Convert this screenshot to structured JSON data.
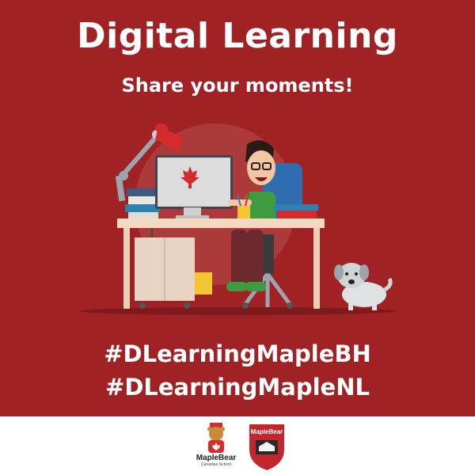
{
  "poster": {
    "title": "Digital Learning",
    "subtitle": "Share your moments!",
    "hashtags": [
      "#DLearningMapleBH",
      "#DLearningMapleNL"
    ],
    "colors": {
      "background": "#a02224",
      "footer": "#ffffff",
      "text": "#ffffff"
    }
  },
  "illustration": {
    "icons": [
      "desk-lamp-icon",
      "book-stack-icon",
      "computer-monitor-icon",
      "maple-leaf-icon",
      "student-character-icon",
      "office-chair-icon",
      "pencil-cup-icon",
      "desk-icon",
      "dog-icon"
    ]
  },
  "footer": {
    "logo1": {
      "name": "MapleBear",
      "subtitle": "Canadian School"
    },
    "logo2": {
      "name": "MapleBear"
    }
  }
}
